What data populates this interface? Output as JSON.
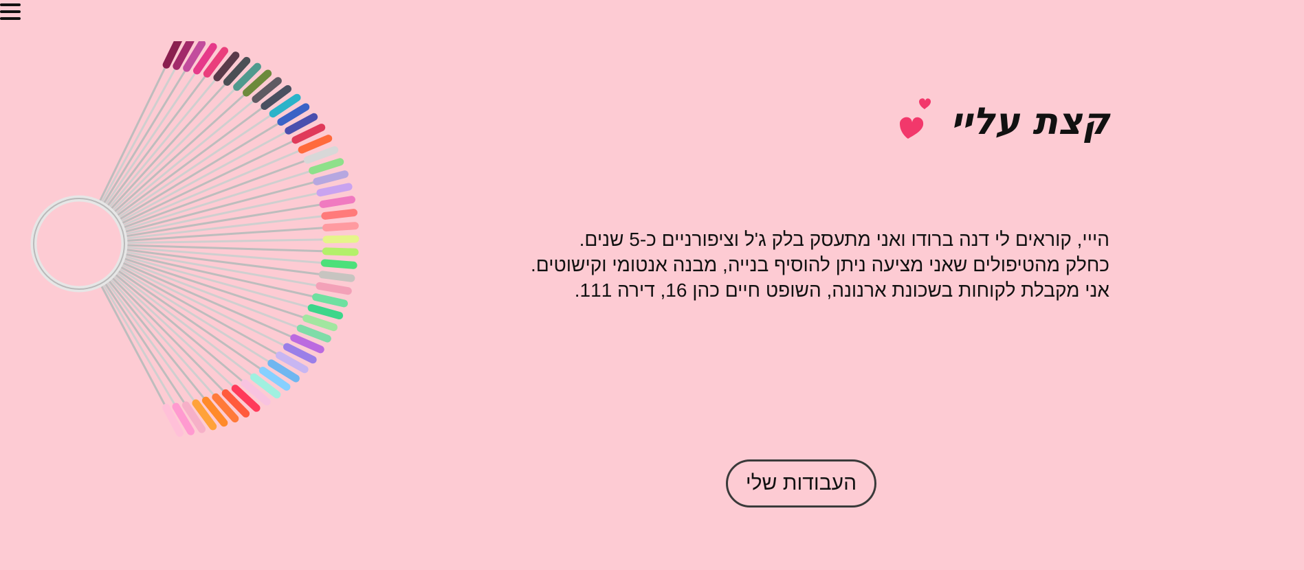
{
  "nav": {
    "menu_icon": "hamburger-icon"
  },
  "about": {
    "title": "קצת עליי",
    "title_icon": "hearts-icon",
    "paragraphs": [
      "הייי, קוראים לי דנה ברודו ואני מתעסק בלק ג'ל וציפורניים כ-5 שנים.",
      "כחלק מהטיפולים שאני מציעה ניתן להוסיף בנייה, מבנה אנטומי וקישוטים.",
      "אני מקבלת לקוחות בשכונת ארנונה, השופט חיים כהן 16, דירה 111."
    ],
    "works_button": "העבודות שלי"
  },
  "colors": {
    "background": "#fdcbd3",
    "heart": "#f2386b",
    "text": "#111111"
  },
  "image": {
    "name": "nail-color-swatch-fan"
  }
}
